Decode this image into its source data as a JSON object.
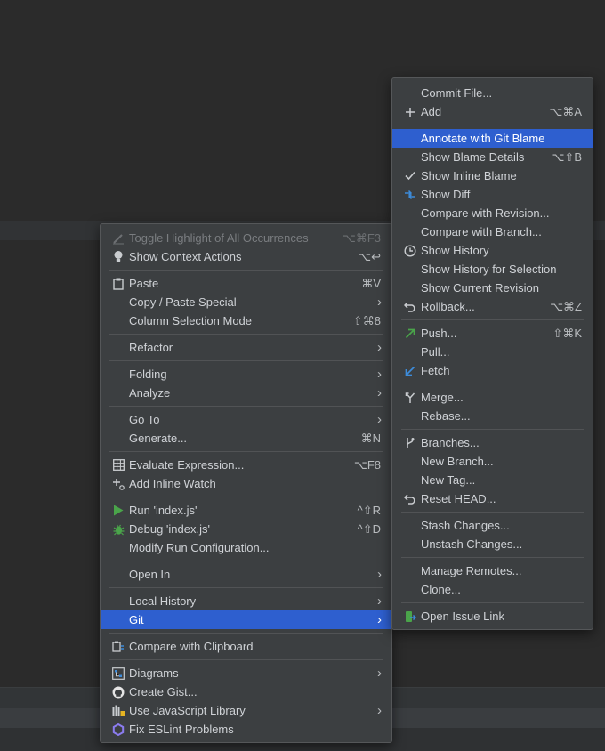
{
  "context_menu": {
    "items": [
      {
        "label": "Toggle Highlight of All Occurrences",
        "shortcut": "⌥⌘F3"
      },
      {
        "label": "Show Context Actions",
        "shortcut": "⌥↩"
      },
      {
        "label": "Paste",
        "shortcut": "⌘V"
      },
      {
        "label": "Copy / Paste Special"
      },
      {
        "label": "Column Selection Mode",
        "shortcut": "⇧⌘8"
      },
      {
        "label": "Refactor"
      },
      {
        "label": "Folding"
      },
      {
        "label": "Analyze"
      },
      {
        "label": "Go To"
      },
      {
        "label": "Generate...",
        "shortcut": "⌘N"
      },
      {
        "label": "Evaluate Expression...",
        "shortcut": "⌥F8"
      },
      {
        "label": "Add Inline Watch"
      },
      {
        "label": "Run 'index.js'",
        "shortcut": "^⇧R"
      },
      {
        "label": "Debug 'index.js'",
        "shortcut": "^⇧D"
      },
      {
        "label": "Modify Run Configuration..."
      },
      {
        "label": "Open In"
      },
      {
        "label": "Local History"
      },
      {
        "label": "Git"
      },
      {
        "label": "Compare with Clipboard"
      },
      {
        "label": "Diagrams"
      },
      {
        "label": "Create Gist..."
      },
      {
        "label": "Use JavaScript Library"
      },
      {
        "label": "Fix ESLint Problems"
      }
    ]
  },
  "git_menu": {
    "items": [
      {
        "label": "Commit File..."
      },
      {
        "label": "Add",
        "shortcut": "⌥⌘A"
      },
      {
        "label": "Annotate with Git Blame"
      },
      {
        "label": "Show Blame Details",
        "shortcut": "⌥⇧B"
      },
      {
        "label": "Show Inline Blame"
      },
      {
        "label": "Show Diff"
      },
      {
        "label": "Compare with Revision..."
      },
      {
        "label": "Compare with Branch..."
      },
      {
        "label": "Show History"
      },
      {
        "label": "Show History for Selection"
      },
      {
        "label": "Show Current Revision"
      },
      {
        "label": "Rollback...",
        "shortcut": "⌥⌘Z"
      },
      {
        "label": "Push...",
        "shortcut": "⇧⌘K"
      },
      {
        "label": "Pull..."
      },
      {
        "label": "Fetch"
      },
      {
        "label": "Merge..."
      },
      {
        "label": "Rebase..."
      },
      {
        "label": "Branches..."
      },
      {
        "label": "New Branch..."
      },
      {
        "label": "New Tag..."
      },
      {
        "label": "Reset HEAD..."
      },
      {
        "label": "Stash Changes..."
      },
      {
        "label": "Unstash Changes..."
      },
      {
        "label": "Manage Remotes..."
      },
      {
        "label": "Clone..."
      },
      {
        "label": "Open Issue Link"
      }
    ]
  },
  "colors": {
    "background": "#2b2b2b",
    "menu_background": "#3c3f41",
    "selection": "#2e5fcf",
    "text": "#cfd2d6",
    "disabled_text": "#7a7d80",
    "run_green": "#4aa44a",
    "vcs_blue": "#3d8bd9",
    "eslint_purple": "#8b7cf0"
  }
}
